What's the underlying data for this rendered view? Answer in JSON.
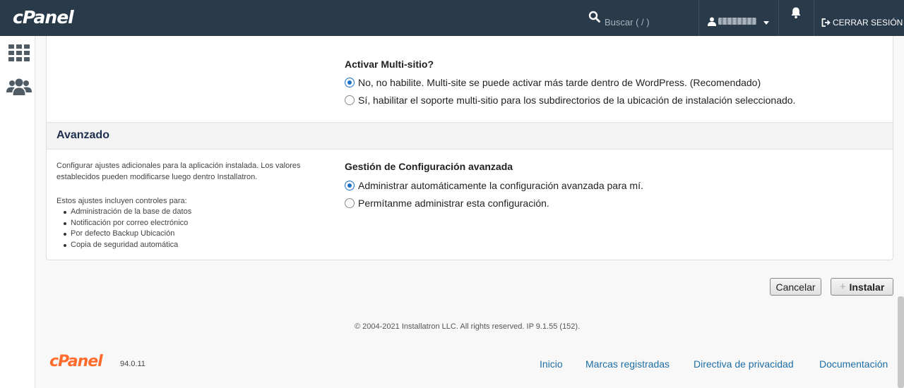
{
  "header": {
    "brand": "cPanel",
    "search_placeholder": "Buscar ( / )",
    "logout_label": "CERRAR SESIÓN",
    "icons": [
      "search-icon",
      "user-icon",
      "bell-icon",
      "logout-icon"
    ]
  },
  "sidebar": {
    "icons": [
      "apps-grid-icon",
      "users-icon"
    ]
  },
  "multisite": {
    "label": "Activar Multi-sitio?",
    "options": [
      {
        "label": "No, no habilite. Multi-site se puede activar más tarde dentro de WordPress. (Recomendado)",
        "checked": true
      },
      {
        "label": "Sí, habilitar el soporte multi-sitio para los subdirectorios de la ubicación de instalación seleccionado.",
        "checked": false
      }
    ]
  },
  "advanced": {
    "title": "Avanzado",
    "description_line1": "Configurar ajustes adicionales para la aplicación instalada. Los valores",
    "description_line2": "establecidos pueden modificarse luego dentro Installatron.",
    "includes_label": "Estos ajustes incluyen controles para:",
    "includes": [
      "Administración de la base de datos",
      "Notificación por correo electrónico",
      "Por defecto Backup Ubicación",
      "Copia de seguridad automática"
    ],
    "config_label": "Gestión de Configuración avanzada",
    "options": [
      {
        "label": "Administrar automáticamente la configuración avanzada para mí.",
        "checked": true
      },
      {
        "label": "Permítanme administrar esta configuración.",
        "checked": false
      }
    ]
  },
  "actions": {
    "cancel_label": "Cancelar",
    "install_label": "Instalar"
  },
  "copyright": "© 2004-2021 Installatron LLC. All rights reserved. IP 9.1.55 (152).",
  "footer": {
    "brand": "cPanel",
    "version": "94.0.11",
    "links": [
      "Inicio",
      "Marcas registradas",
      "Directiva de privacidad",
      "Documentación"
    ]
  },
  "colors": {
    "topbar": "#293a4a",
    "accent": "#1a6fc6",
    "link": "#1c6ea4",
    "brand_orange": "#ff6c2c"
  }
}
